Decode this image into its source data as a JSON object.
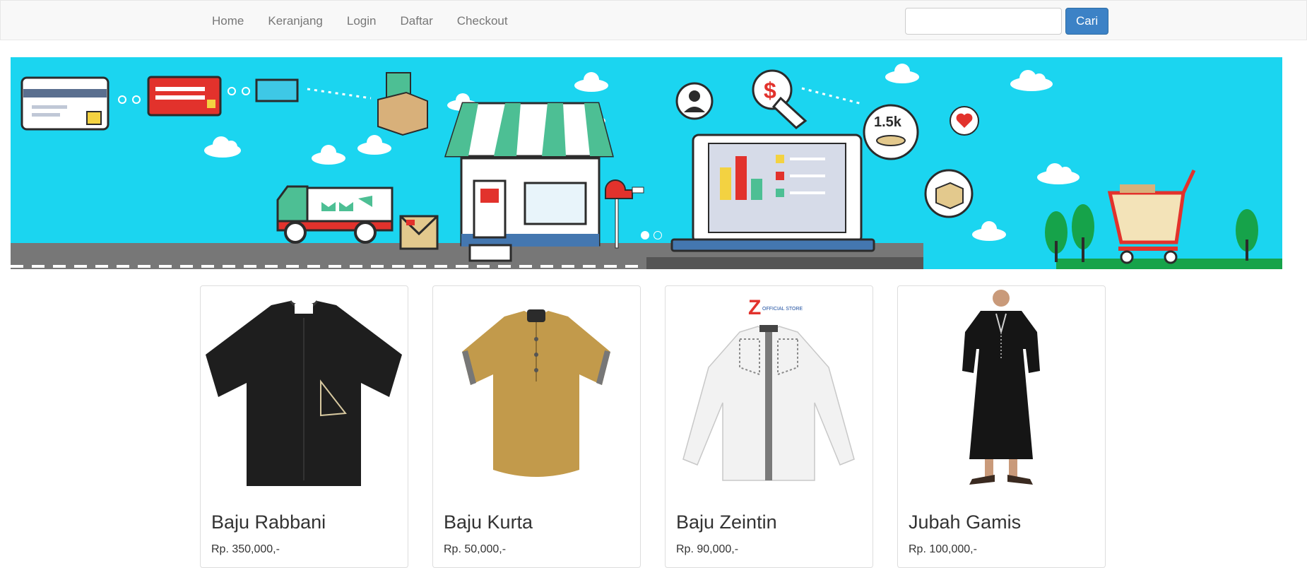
{
  "nav": {
    "links": [
      "Home",
      "Keranjang",
      "Login",
      "Daftar",
      "Checkout"
    ]
  },
  "search": {
    "value": "",
    "placeholder": "",
    "button_label": "Cari"
  },
  "banner": {
    "colors": {
      "sky": "#1bd5f0",
      "road": "#777777",
      "awning": "#4dbf94",
      "cart": "#e2322c"
    },
    "badge_text": "1.5k",
    "dollar_sign": "$",
    "carousel_slides": 2,
    "active_slide": 1
  },
  "products": [
    {
      "name": "Baju Rabbani",
      "price": "Rp. 350,000,-",
      "color": "#1e1e1e",
      "style": "short-sleeve-shirt"
    },
    {
      "name": "Baju Kurta",
      "price": "Rp. 50,000,-",
      "color": "#c29a4b",
      "style": "kurta"
    },
    {
      "name": "Baju Zeintin",
      "price": "Rp. 90,000,-",
      "color": "#f2f2f2",
      "style": "long-sleeve-koko",
      "logo_text": "Z",
      "logo_caption": "OFFICIAL STORE"
    },
    {
      "name": "Jubah Gamis",
      "price": "Rp. 100,000,-",
      "color": "#151515",
      "style": "gamis"
    }
  ]
}
